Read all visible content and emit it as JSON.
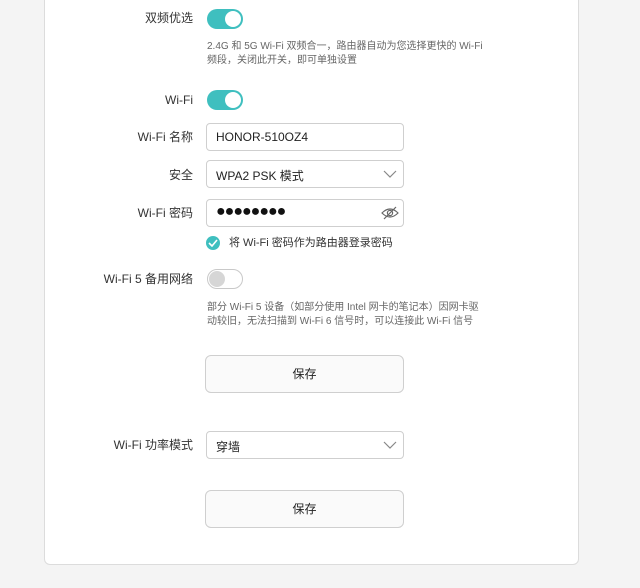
{
  "dual_band": {
    "label": "双频优选",
    "state": "on",
    "description": "2.4G 和 5G Wi-Fi 双频合一，路由器自动为您选择更快的 Wi-Fi 频段，关闭此开关，即可单独设置"
  },
  "wifi": {
    "label": "Wi-Fi",
    "state": "on"
  },
  "wifi_name": {
    "label": "Wi-Fi 名称",
    "value": "HONOR-510OZ4"
  },
  "security": {
    "label": "安全",
    "selected": "WPA2 PSK 模式"
  },
  "wifi_password": {
    "label": "Wi-Fi 密码",
    "masked_value": "●●●●●●●●",
    "icon": "eye-hidden-icon"
  },
  "use_as_login": {
    "label": "将 Wi-Fi 密码作为路由器登录密码",
    "checked": true
  },
  "wifi5_backup": {
    "label": "Wi-Fi 5 备用网络",
    "state": "off",
    "description": "部分 Wi-Fi 5 设备（如部分使用 Intel 网卡的笔记本）因网卡驱动较旧，无法扫描到 Wi-Fi 6 信号时，可以连接此 Wi-Fi 信号"
  },
  "save1": {
    "label": "保存"
  },
  "power_mode": {
    "label": "Wi-Fi 功率模式",
    "selected": "穿墙"
  },
  "save2": {
    "label": "保存"
  },
  "colors": {
    "accent": "#3fbfbf",
    "background": "#f4f4f4",
    "panel": "#ffffff"
  }
}
